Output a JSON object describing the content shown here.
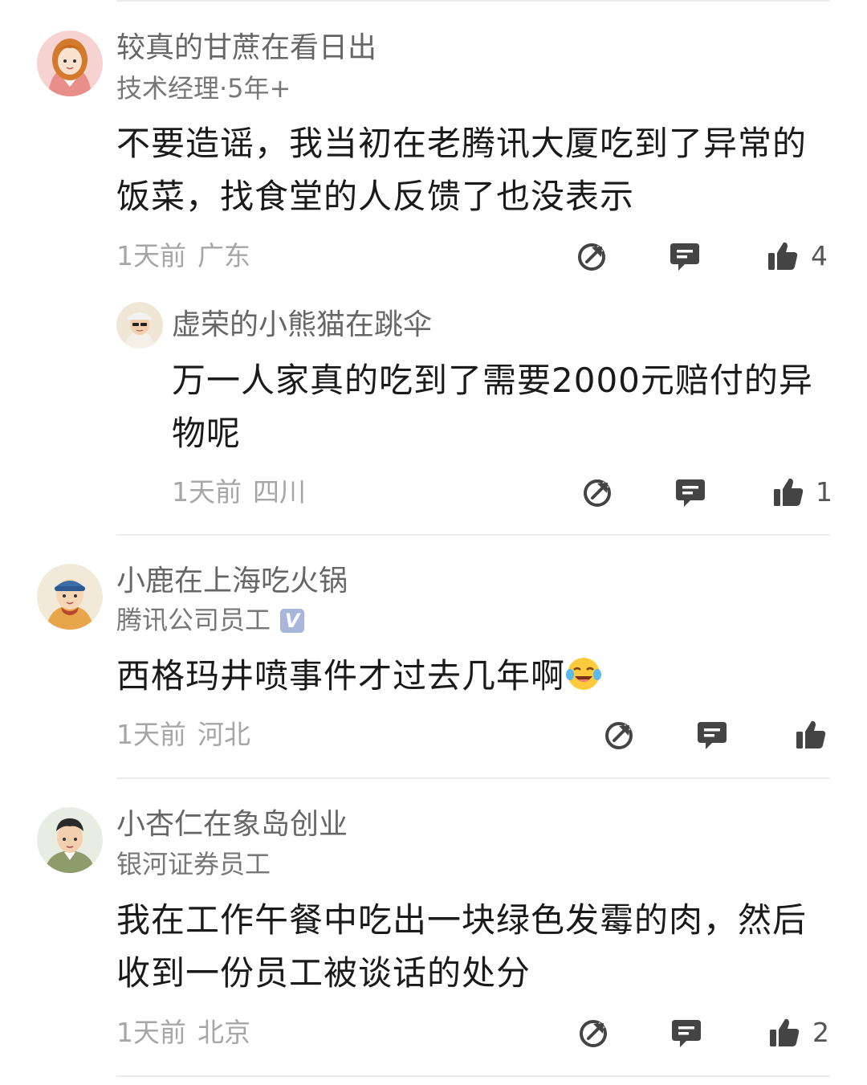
{
  "comments": [
    {
      "username": "较真的甘蔗在看日出",
      "tag": "技术经理·5年+",
      "text": "不要造谣，我当初在老腾讯大厦吃到了异常的饭菜，找食堂的人反馈了也没表示",
      "time": "1天前",
      "location": "广东",
      "likes": "4",
      "reply": {
        "username": "虚荣的小熊猫在跳伞",
        "text": "万一人家真的吃到了需要2000元赔付的异物呢",
        "time": "1天前",
        "location": "四川",
        "likes": "1"
      }
    },
    {
      "username": "小鹿在上海吃火锅",
      "tag": "腾讯公司员工",
      "verified_badge": "V",
      "text": "西格玛井喷事件才过去几年啊",
      "emoji": "laughing-tears-emoji",
      "time": "1天前",
      "location": "河北",
      "likes": ""
    },
    {
      "username": "小杏仁在象岛创业",
      "tag": "银河证券员工",
      "text": "我在工作午餐中吃出一块绿色发霉的肉，然后收到一份员工被谈话的处分",
      "time": "1天前",
      "location": "北京",
      "likes": "2"
    }
  ],
  "icons": {
    "share": "share-icon",
    "comment": "comment-icon",
    "like": "thumbs-up-icon"
  },
  "colors": {
    "icon": "#444444",
    "meta": "#a6a6a6",
    "badge": "#a8b6dc"
  }
}
